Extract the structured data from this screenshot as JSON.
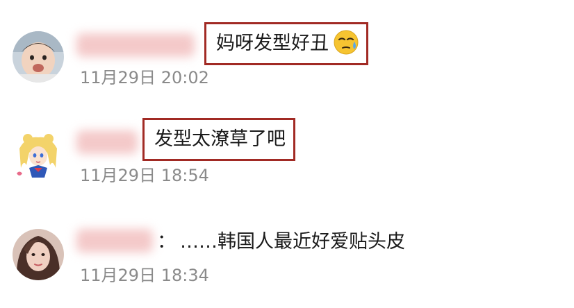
{
  "comments": [
    {
      "avatar": "baby-avatar",
      "text": "妈呀发型好丑",
      "emoji": "sweat-face-emoji",
      "timestamp": "11月29日 20:02",
      "highlighted": true
    },
    {
      "avatar": "sailor-moon-avatar",
      "text": "发型太潦草了吧",
      "timestamp": "11月29日 18:54",
      "highlighted": true
    },
    {
      "avatar": "woman-avatar",
      "separator": "：",
      "text": "……韩国人最近好爱贴头皮",
      "timestamp": "11月29日 18:34",
      "highlighted": false
    }
  ],
  "colors": {
    "highlight_border": "#a12a24",
    "timestamp": "#8a8a8a",
    "text": "#1a1a1a",
    "name_blur": "#f4c9c9"
  }
}
